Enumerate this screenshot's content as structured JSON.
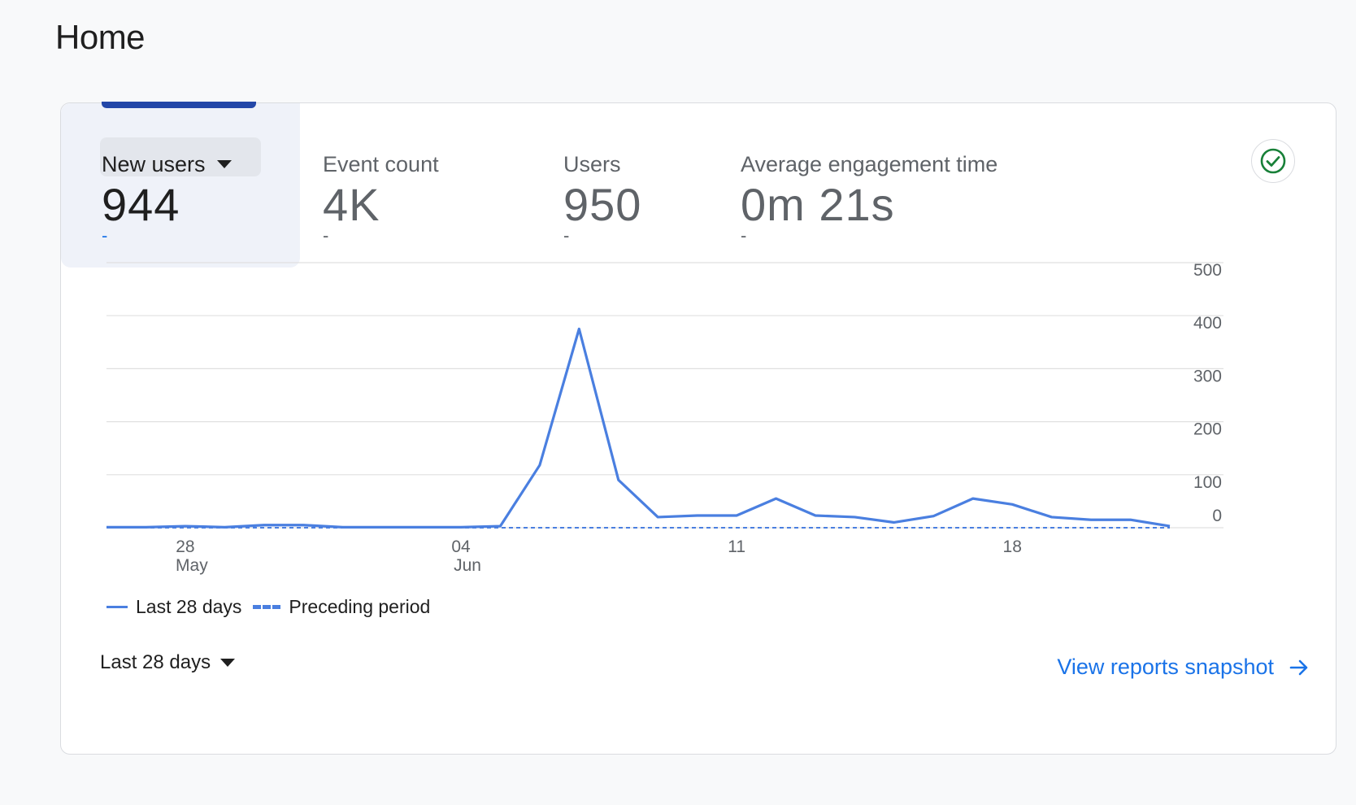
{
  "page": {
    "title": "Home"
  },
  "metrics": [
    {
      "label": "New users",
      "value": "944",
      "delta": "-",
      "selected": true
    },
    {
      "label": "Event count",
      "value": "4K",
      "delta": "-"
    },
    {
      "label": "Users",
      "value": "950",
      "delta": "-"
    },
    {
      "label": "Average engagement time",
      "value": "0m 21s",
      "delta": "-"
    }
  ],
  "icons": {
    "status": "check-circle-icon",
    "dropdown": "caret-down-icon",
    "link": "arrow-right-icon"
  },
  "colors": {
    "series": "#4a7fe0",
    "accent": "#1a73e8",
    "selected_tab_bar": "#2347a8",
    "check_green": "#188038"
  },
  "chart_data": {
    "type": "line",
    "x_tick_labels": [
      {
        "day": "28",
        "month": "May",
        "index": 2
      },
      {
        "day": "04",
        "month": "Jun",
        "index": 9
      },
      {
        "day": "11",
        "month": "",
        "index": 16
      },
      {
        "day": "18",
        "month": "",
        "index": 23
      }
    ],
    "ylim": [
      0,
      500
    ],
    "y_ticks": [
      0,
      100,
      200,
      300,
      400,
      500
    ],
    "grid": true,
    "legend_position": "bottom-left",
    "series": [
      {
        "name": "Last 28 days",
        "style": "solid",
        "values": [
          1,
          1,
          3,
          1,
          5,
          5,
          1,
          1,
          1,
          1,
          3,
          118,
          375,
          90,
          20,
          23,
          23,
          55,
          23,
          20,
          10,
          22,
          55,
          44,
          20,
          15,
          15,
          3
        ]
      },
      {
        "name": "Preceding period",
        "style": "dashed",
        "values": [
          0,
          0,
          0,
          0,
          0,
          0,
          0,
          0,
          0,
          0,
          0,
          0,
          0,
          0,
          0,
          0,
          0,
          0,
          0,
          0,
          0,
          0,
          0,
          0,
          0,
          0,
          0,
          0
        ]
      }
    ]
  },
  "footer": {
    "range_label": "Last 28 days",
    "link_label": "View reports snapshot"
  }
}
